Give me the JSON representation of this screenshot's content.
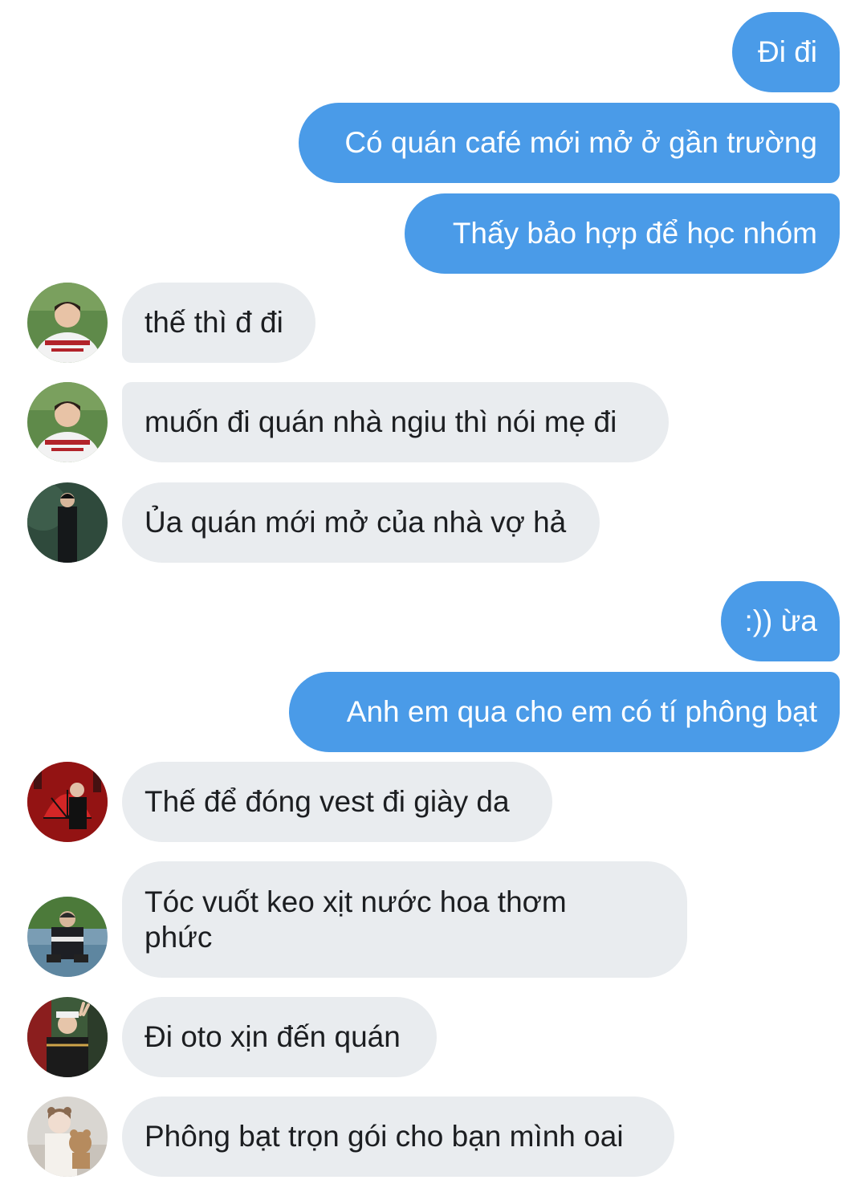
{
  "colors": {
    "outgoing_bubble": "#4a9be8",
    "incoming_bubble": "#e9ecef",
    "outgoing_text": "#ffffff",
    "incoming_text": "#1c1e21"
  },
  "messages": [
    {
      "direction": "outgoing",
      "text": "Đi đi"
    },
    {
      "direction": "outgoing",
      "text": "Có quán café mới mở ở gần trường"
    },
    {
      "direction": "outgoing",
      "text": "Thấy bảo hợp để học nhóm"
    },
    {
      "direction": "incoming",
      "avatar": "avatar-baseball-jersey",
      "text": "thế thì đ đi"
    },
    {
      "direction": "incoming",
      "avatar": "avatar-baseball-jersey",
      "text": "muốn đi quán nhà ngiu thì nói mẹ đi"
    },
    {
      "direction": "incoming",
      "avatar": "avatar-black-suit",
      "text": "Ủa quán mới mở của nhà vợ hả"
    },
    {
      "direction": "outgoing",
      "text": ":)) ừa"
    },
    {
      "direction": "outgoing",
      "text": "Anh em qua cho em có tí phông bạt"
    },
    {
      "direction": "incoming",
      "avatar": "avatar-red-fan",
      "text": "Thế để đóng vest đi giày da"
    },
    {
      "direction": "incoming",
      "avatar": "avatar-field-sitting",
      "text": "Tóc vuốt keo xịt nước hoa thơm phức"
    },
    {
      "direction": "incoming",
      "avatar": "avatar-peace-sign",
      "text": "Đi oto xịn đến quán"
    },
    {
      "direction": "incoming",
      "avatar": "avatar-teddy-bear",
      "text": "Phông bạt trọn gói cho bạn mình oai"
    }
  ]
}
